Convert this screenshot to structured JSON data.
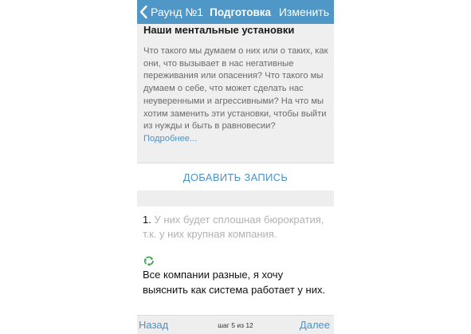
{
  "nav": {
    "back_label": "Раунд №1",
    "title": "Подготовка",
    "edit_label": "Изменить"
  },
  "card": {
    "title": "Наши ментальные установки",
    "body": "Что такого мы думаем о них или о таких, как они, что вызывает в нас негативные переживания или опасения? Что такого мы думаем о себе, что может сделать нас неуверенными и агрессивными? На что мы хотим заменить эти установки, чтобы выйти из нужды и быть в равновесии?",
    "more_link": "Подробнее..."
  },
  "add_entry_label": "ДОБАВИТЬ ЗАПИСЬ",
  "entry": {
    "number": "1.",
    "text": "У них будет сплошная бюрократия, т.к. у них крупная компания.",
    "icon": "recycle-icon",
    "reply": "Все компании разные, я хочу выяснить как система работает у них."
  },
  "toolbar": {
    "back_label": "Назад",
    "step_label": "шаг 5 из 12",
    "next_label": "Далее"
  },
  "colors": {
    "navbar": "#4f97c7",
    "accent": "#4b93c8",
    "recycle": "#3aa655"
  }
}
